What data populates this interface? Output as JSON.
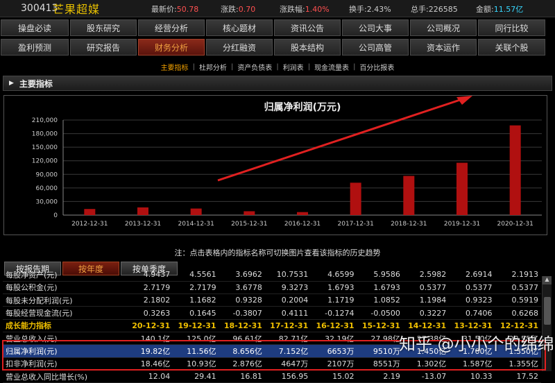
{
  "header": {
    "code": "300413",
    "name": "芒果超媒",
    "quotes": [
      {
        "label": "最新价:",
        "value": "50.78",
        "color": "red"
      },
      {
        "label": "涨跌:",
        "value": "0.70",
        "color": "red"
      },
      {
        "label": "涨跌幅:",
        "value": "1.40%",
        "color": "red"
      },
      {
        "label": "换手:",
        "value": "2.43%",
        "color": "plain"
      },
      {
        "label": "总手:",
        "value": "226585",
        "color": "plain"
      },
      {
        "label": "金额:",
        "value": "11.57亿",
        "color": "cyan"
      }
    ]
  },
  "nav_row1": [
    "操盘必读",
    "股东研究",
    "经营分析",
    "核心题材",
    "资讯公告",
    "公司大事",
    "公司概况",
    "同行比较"
  ],
  "nav_row2": [
    "盈利预测",
    "研究报告",
    "财务分析",
    "分红融资",
    "股本结构",
    "公司高管",
    "资本运作",
    "关联个股"
  ],
  "nav_active": "财务分析",
  "subnav": [
    "主要指标",
    "杜邦分析",
    "资产负债表",
    "利润表",
    "现金流量表",
    "百分比报表"
  ],
  "subnav_active": "主要指标",
  "section_title": "主要指标",
  "chart_data": {
    "type": "bar",
    "title": "归属净利润(万元)",
    "categories": [
      "2012-12-31",
      "2013-12-31",
      "2014-12-31",
      "2015-12-31",
      "2016-12-31",
      "2017-12-31",
      "2018-12-31",
      "2019-12-31",
      "2020-12-31"
    ],
    "values": [
      13500,
      17000,
      14500,
      8500,
      6653,
      71520,
      86560,
      115600,
      198200
    ],
    "ylim": [
      0,
      210000
    ],
    "yticks": [
      0,
      30000,
      60000,
      90000,
      120000,
      150000,
      180000,
      210000
    ],
    "ytick_labels": [
      "0",
      "30,000",
      "60,000",
      "90,000",
      "120,000",
      "150,000",
      "180,000",
      "210,000"
    ],
    "bar_color": "#b01010",
    "grid": true
  },
  "note": "注：点击表格内的指标名称可切换图片查看该指标的历史趋势",
  "bottom_tabs": [
    "按报告期",
    "按年度",
    "按单季度"
  ],
  "bottom_tab_active": "按年度",
  "table": {
    "rows": [
      {
        "type": "row",
        "label": "每股净资产(元)",
        "values": [
          "4.9437",
          "4.5561",
          "3.6962",
          "10.7531",
          "4.6599",
          "5.9586",
          "2.5982",
          "2.6914",
          "2.1913"
        ]
      },
      {
        "type": "row",
        "label": "每股公积金(元)",
        "values": [
          "2.7179",
          "2.7179",
          "3.6778",
          "9.3273",
          "1.6793",
          "1.6793",
          "0.5377",
          "0.5377",
          "0.5377"
        ]
      },
      {
        "type": "row",
        "label": "每股未分配利润(元)",
        "values": [
          "2.1802",
          "1.1682",
          "0.9328",
          "0.2004",
          "1.1719",
          "1.0852",
          "1.1984",
          "0.9323",
          "0.5919"
        ]
      },
      {
        "type": "row",
        "label": "每股经营现金流(元)",
        "values": [
          "0.3263",
          "0.1645",
          "-0.3807",
          "0.4111",
          "-0.1274",
          "-0.0500",
          "0.3227",
          "0.7406",
          "0.6268"
        ]
      },
      {
        "type": "group",
        "label": "成长能力指标",
        "values": [
          "20-12-31",
          "19-12-31",
          "18-12-31",
          "17-12-31",
          "16-12-31",
          "15-12-31",
          "14-12-31",
          "13-12-31",
          "12-12-31"
        ]
      },
      {
        "type": "row",
        "label": "营业总收入(元)",
        "values": [
          "140.1亿",
          "125.0亿",
          "96.61亿",
          "82.71亿",
          "32.19亿",
          "27.98亿",
          "27.38亿",
          "31.50亿",
          "28.55亿"
        ]
      },
      {
        "type": "hl",
        "label": "归属净利润(元)",
        "values": [
          "19.82亿",
          "11.56亿",
          "8.656亿",
          "7.152亿",
          "6653万",
          "9510万",
          "1.450亿",
          "1.700亿",
          "1.350亿"
        ]
      },
      {
        "type": "row",
        "label": "扣非净利润(元)",
        "values": [
          "18.46亿",
          "10.93亿",
          "2.876亿",
          "4647万",
          "2107万",
          "8551万",
          "1.302亿",
          "1.587亿",
          "1.355亿"
        ]
      },
      {
        "type": "row",
        "label": "营业总收入同比增长(%)",
        "values": [
          "12.04",
          "29.41",
          "16.81",
          "156.95",
          "15.02",
          "2.19",
          "-13.07",
          "10.33",
          "17.52"
        ]
      }
    ]
  },
  "watermark": "知乎 @小小个的绵绵"
}
